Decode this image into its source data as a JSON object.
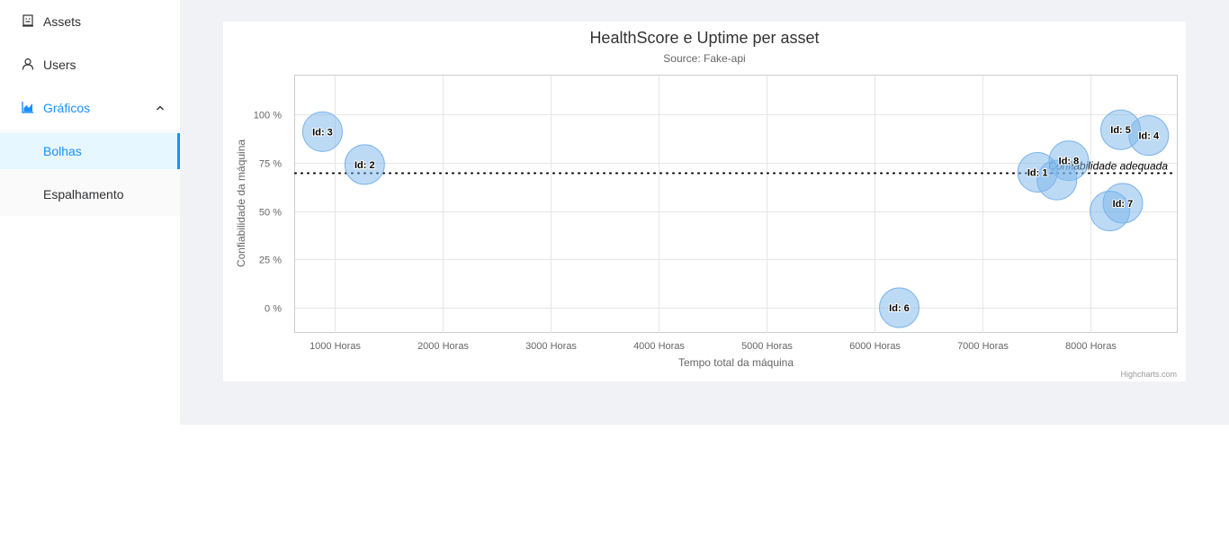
{
  "sidebar": {
    "items": [
      {
        "label": "Assets",
        "icon": "building-icon"
      },
      {
        "label": "Users",
        "icon": "user-icon"
      },
      {
        "label": "Gráficos",
        "icon": "area-chart-icon",
        "expanded": true
      }
    ],
    "submenu": [
      {
        "label": "Bolhas",
        "selected": true
      },
      {
        "label": "Espalhamento",
        "selected": false
      }
    ],
    "accent_color": "#1890ff"
  },
  "chart_data": {
    "type": "bubble",
    "title": "HealthScore e Uptime per asset",
    "subtitle": "Source: Fake-api",
    "xlabel": "Tempo total da máquina",
    "ylabel": "Confiabilidade da máquina",
    "xticks": [
      {
        "value": 1000,
        "label": "1000 Horas"
      },
      {
        "value": 2000,
        "label": "2000 Horas"
      },
      {
        "value": 3000,
        "label": "3000 Horas"
      },
      {
        "value": 4000,
        "label": "4000 Horas"
      },
      {
        "value": 5000,
        "label": "5000 Horas"
      },
      {
        "value": 6000,
        "label": "6000 Horas"
      },
      {
        "value": 7000,
        "label": "7000 Horas"
      },
      {
        "value": 8000,
        "label": "8000 Horas"
      }
    ],
    "yticks": [
      {
        "value": 0,
        "label": "0 %"
      },
      {
        "value": 25,
        "label": "25 %"
      },
      {
        "value": 50,
        "label": "50 %"
      },
      {
        "value": 75,
        "label": "75 %"
      },
      {
        "value": 100,
        "label": "100 %"
      }
    ],
    "xlim": [
      636,
      8800
    ],
    "ylim": [
      -13,
      120
    ],
    "grid": true,
    "bubble_color": "#7cb5ec",
    "points": [
      {
        "label": "Id: 3",
        "x": 890,
        "y": 91
      },
      {
        "label": "Id: 2",
        "x": 1280,
        "y": 74
      },
      {
        "label": "Id: 6",
        "x": 6230,
        "y": 0
      },
      {
        "label": "Id: 1",
        "x": 7510,
        "y": 70
      },
      {
        "label": "",
        "x": 7690,
        "y": 66
      },
      {
        "label": "Id: 8",
        "x": 7800,
        "y": 76
      },
      {
        "label": "Id: 5",
        "x": 8280,
        "y": 92
      },
      {
        "label": "Id: 4",
        "x": 8540,
        "y": 89
      },
      {
        "label": "",
        "x": 8180,
        "y": 50
      },
      {
        "label": "Id: 7",
        "x": 8300,
        "y": 54
      }
    ],
    "plot_line": {
      "value": 70,
      "label": "Confiabilidade adequada",
      "style": "dotted",
      "color": "#000000"
    },
    "credits": "Highcharts.com"
  }
}
